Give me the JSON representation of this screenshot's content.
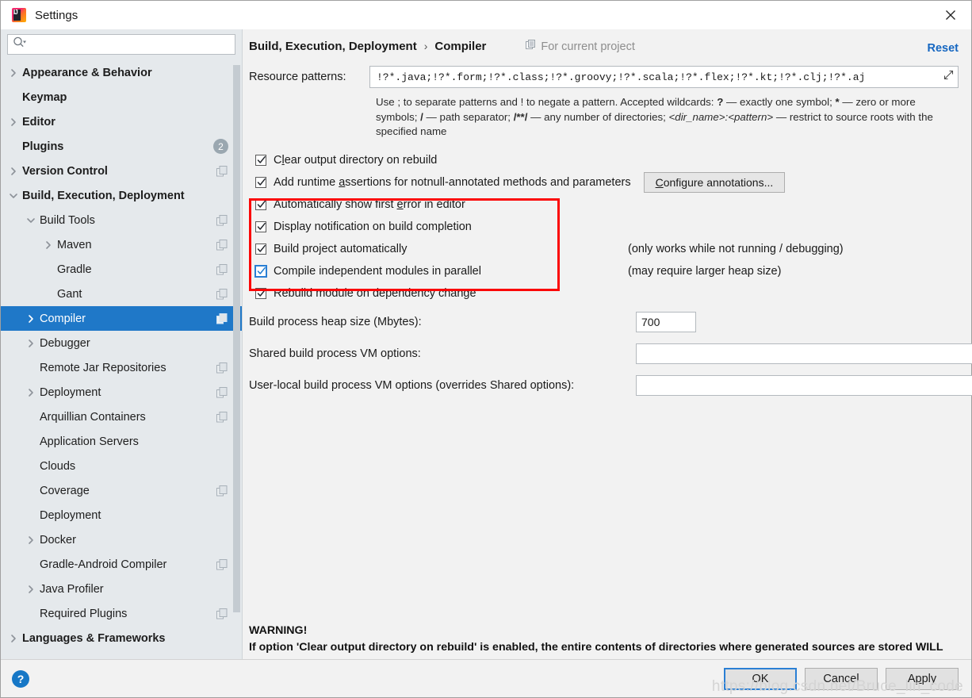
{
  "window": {
    "title": "Settings",
    "app_icon": "intellij-idea-icon",
    "close_icon": "close-icon"
  },
  "sidebar": {
    "search": {
      "placeholder": "",
      "value": "",
      "icon": "search-icon"
    },
    "items": [
      {
        "label": "Appearance & Behavior",
        "indent": 0,
        "bold": true,
        "arrow": "right",
        "badge": null,
        "config_icon": false,
        "selected": false
      },
      {
        "label": "Keymap",
        "indent": 0,
        "bold": true,
        "arrow": "none",
        "badge": null,
        "config_icon": false,
        "selected": false
      },
      {
        "label": "Editor",
        "indent": 0,
        "bold": true,
        "arrow": "right",
        "badge": null,
        "config_icon": false,
        "selected": false
      },
      {
        "label": "Plugins",
        "indent": 0,
        "bold": true,
        "arrow": "none",
        "badge": "2",
        "config_icon": false,
        "selected": false
      },
      {
        "label": "Version Control",
        "indent": 0,
        "bold": true,
        "arrow": "right",
        "badge": null,
        "config_icon": true,
        "selected": false
      },
      {
        "label": "Build, Execution, Deployment",
        "indent": 0,
        "bold": true,
        "arrow": "down",
        "badge": null,
        "config_icon": false,
        "selected": false
      },
      {
        "label": "Build Tools",
        "indent": 1,
        "bold": false,
        "arrow": "down",
        "badge": null,
        "config_icon": true,
        "selected": false
      },
      {
        "label": "Maven",
        "indent": 2,
        "bold": false,
        "arrow": "right",
        "badge": null,
        "config_icon": true,
        "selected": false
      },
      {
        "label": "Gradle",
        "indent": 2,
        "bold": false,
        "arrow": "none",
        "badge": null,
        "config_icon": true,
        "selected": false
      },
      {
        "label": "Gant",
        "indent": 2,
        "bold": false,
        "arrow": "none",
        "badge": null,
        "config_icon": true,
        "selected": false
      },
      {
        "label": "Compiler",
        "indent": 1,
        "bold": false,
        "arrow": "right",
        "badge": null,
        "config_icon": true,
        "selected": true
      },
      {
        "label": "Debugger",
        "indent": 1,
        "bold": false,
        "arrow": "right",
        "badge": null,
        "config_icon": false,
        "selected": false
      },
      {
        "label": "Remote Jar Repositories",
        "indent": 1,
        "bold": false,
        "arrow": "none",
        "badge": null,
        "config_icon": true,
        "selected": false
      },
      {
        "label": "Deployment",
        "indent": 1,
        "bold": false,
        "arrow": "right",
        "badge": null,
        "config_icon": true,
        "selected": false
      },
      {
        "label": "Arquillian Containers",
        "indent": 1,
        "bold": false,
        "arrow": "none",
        "badge": null,
        "config_icon": true,
        "selected": false
      },
      {
        "label": "Application Servers",
        "indent": 1,
        "bold": false,
        "arrow": "none",
        "badge": null,
        "config_icon": false,
        "selected": false
      },
      {
        "label": "Clouds",
        "indent": 1,
        "bold": false,
        "arrow": "none",
        "badge": null,
        "config_icon": false,
        "selected": false
      },
      {
        "label": "Coverage",
        "indent": 1,
        "bold": false,
        "arrow": "none",
        "badge": null,
        "config_icon": true,
        "selected": false
      },
      {
        "label": "Deployment",
        "indent": 1,
        "bold": false,
        "arrow": "none",
        "badge": null,
        "config_icon": false,
        "selected": false
      },
      {
        "label": "Docker",
        "indent": 1,
        "bold": false,
        "arrow": "right",
        "badge": null,
        "config_icon": false,
        "selected": false
      },
      {
        "label": "Gradle-Android Compiler",
        "indent": 1,
        "bold": false,
        "arrow": "none",
        "badge": null,
        "config_icon": true,
        "selected": false
      },
      {
        "label": "Java Profiler",
        "indent": 1,
        "bold": false,
        "arrow": "right",
        "badge": null,
        "config_icon": false,
        "selected": false
      },
      {
        "label": "Required Plugins",
        "indent": 1,
        "bold": false,
        "arrow": "none",
        "badge": null,
        "config_icon": true,
        "selected": false
      },
      {
        "label": "Languages & Frameworks",
        "indent": 0,
        "bold": true,
        "arrow": "right",
        "badge": null,
        "config_icon": false,
        "selected": false
      }
    ]
  },
  "header": {
    "breadcrumb_parent": "Build, Execution, Deployment",
    "breadcrumb_sep": "›",
    "breadcrumb_current": "Compiler",
    "scope_label": "For current project",
    "scope_icon": "project-scope-icon",
    "reset_label": "Reset"
  },
  "main": {
    "resource_patterns_label": "Resource patterns:",
    "resource_patterns_value": "!?*.java;!?*.form;!?*.class;!?*.groovy;!?*.scala;!?*.flex;!?*.kt;!?*.clj;!?*.aj",
    "expand_icon": "expand-editor-icon",
    "hint_part1": "Use ; to separate patterns and ! to negate a pattern. Accepted wildcards: ",
    "hint_q": "?",
    "hint_part2": " — exactly one symbol; ",
    "hint_star": "*",
    "hint_part3": " — zero or more symbols; ",
    "hint_slash": "/",
    "hint_part4": " — path separator; ",
    "hint_globstar": "/**/",
    "hint_part5": " — any number of directories;  ",
    "hint_dirname": "<dir_name>:<pattern>",
    "hint_part6": " — restrict to source roots with the specified name",
    "checkboxes": [
      {
        "label_pre": "C",
        "label_u": "l",
        "label_post": "ear output directory on rebuild",
        "checked": true,
        "focused": false,
        "note": "",
        "button": null
      },
      {
        "label_pre": "Add runtime ",
        "label_u": "a",
        "label_post": "ssertions for notnull-annotated methods and parameters",
        "checked": true,
        "focused": false,
        "note": "",
        "button": "Configure annotations..."
      },
      {
        "label_pre": "Automatically show first ",
        "label_u": "e",
        "label_post": "rror in editor",
        "checked": true,
        "focused": false,
        "note": "",
        "button": null
      },
      {
        "label_pre": "Display notification on build completion",
        "label_u": "",
        "label_post": "",
        "checked": true,
        "focused": false,
        "note": "",
        "button": null
      },
      {
        "label_pre": "Build project automatically",
        "label_u": "",
        "label_post": "",
        "checked": true,
        "focused": false,
        "note": "(only works while not running / debugging)",
        "button": null
      },
      {
        "label_pre": "Compile independent modules in parallel",
        "label_u": "",
        "label_post": "",
        "checked": true,
        "focused": true,
        "note": "(may require larger heap size)",
        "button": null
      },
      {
        "label_pre": "Rebuild module on dependency change",
        "label_u": "",
        "label_post": "",
        "checked": true,
        "focused": false,
        "note": "",
        "button": null
      }
    ],
    "configure_annotations_pre": "C",
    "configure_annotations_u": "",
    "configure_annotations_label": "Configure annotations...",
    "fields": [
      {
        "label": "Build process heap size (Mbytes):",
        "value": "700",
        "placeholder": "",
        "kind": "heap"
      },
      {
        "label": "Shared build process VM options:",
        "value": "",
        "placeholder": "",
        "kind": "vm"
      },
      {
        "label": "User-local build process VM options (overrides Shared options):",
        "value": "",
        "placeholder": "",
        "kind": "vm2"
      }
    ],
    "warning_title": "WARNING!",
    "warning_body": "If option 'Clear output directory on rebuild' is enabled, the entire contents of directories where generated sources are stored WILL BE CLEARED on rebuild."
  },
  "footer": {
    "help_label": "?",
    "ok_label": "OK",
    "cancel_label": "Cancel",
    "apply_pre": "A",
    "apply_u": "p",
    "apply_post": "ply",
    "apply_label": "Apply"
  },
  "watermark": "https://blog.csdn.net/Bruce_lin_code",
  "colors": {
    "selection": "#1f78c8",
    "link": "#1667c1",
    "highlight_box": "#fb0707",
    "sidebar_bg": "#e5e9ec",
    "content_bg": "#f2f2f2",
    "focus_blue": "#2a7fd4"
  }
}
